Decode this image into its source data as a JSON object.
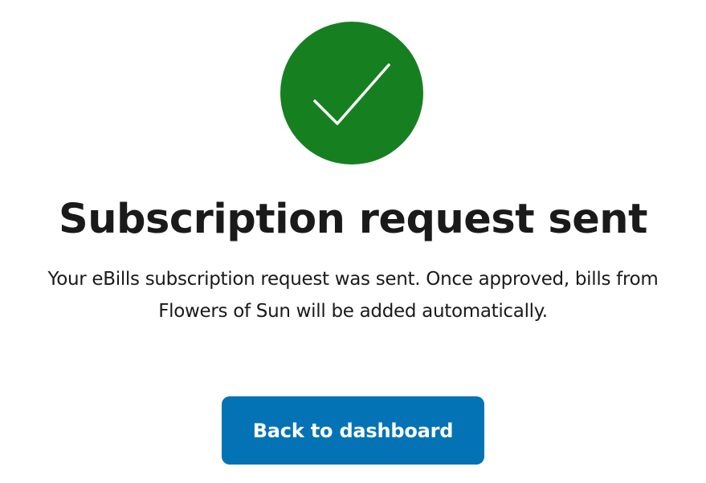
{
  "status": {
    "icon": "checkmark-icon",
    "color": "#168021"
  },
  "confirmation": {
    "title": "Subscription request sent",
    "message_line1": "Your eBills subscription request was sent. Once approved, bills from",
    "message_line2": "Flowers of Sun will be added automatically."
  },
  "actions": {
    "back_label": "Back to dashboard",
    "button_color": "#0473b5"
  }
}
